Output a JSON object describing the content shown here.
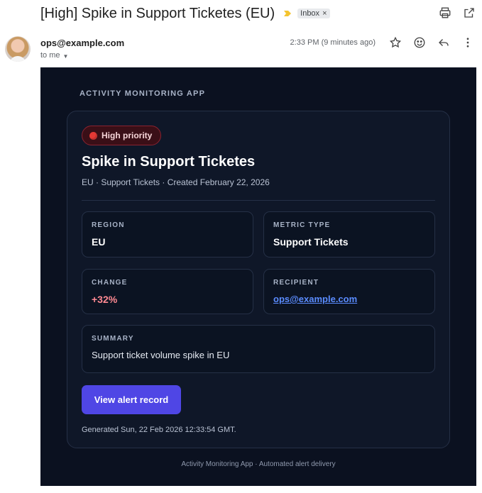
{
  "header": {
    "subject": "[High] Spike in Support Ticketes (EU)",
    "label": "Inbox",
    "label_remove": "×"
  },
  "sender": {
    "email": "ops@example.com",
    "to": "to me",
    "time": "2:33 PM (9 minutes ago)"
  },
  "icons": [
    "importance-marker-icon",
    "print-icon",
    "open-new-window-icon",
    "star-icon",
    "emoji-icon",
    "reply-icon",
    "more-vert-icon"
  ],
  "colors": {
    "accent": "#4f46e5",
    "background": "#0b1120",
    "priority_red": "#e53935",
    "link": "#5b8cff"
  },
  "body": {
    "app_name": "ACTIVITY MONITORING APP",
    "priority": "High priority",
    "title": "Spike in Support Ticketes",
    "subtitle": "EU · Support Tickets · Created February 22, 2026",
    "fields": {
      "region": {
        "label": "REGION",
        "value": "EU"
      },
      "metric_type": {
        "label": "METRIC TYPE",
        "value": "Support Tickets"
      },
      "change": {
        "label": "CHANGE",
        "value": "+32%"
      },
      "recipient": {
        "label": "RECIPIENT",
        "value": "ops@example.com"
      },
      "summary": {
        "label": "SUMMARY",
        "value": "Support ticket volume spike in EU"
      }
    },
    "cta": "View alert record",
    "generated": "Generated Sun, 22 Feb 2026 12:33:54 GMT.",
    "footer": "Activity Monitoring App · Automated alert delivery"
  }
}
